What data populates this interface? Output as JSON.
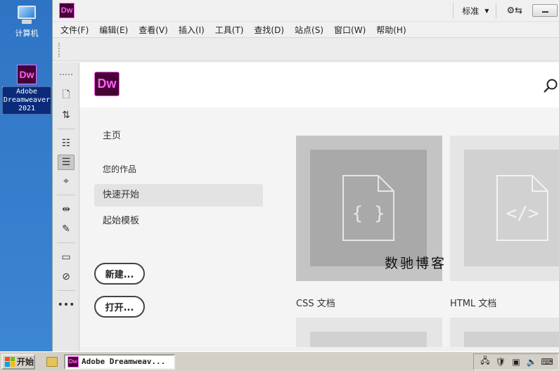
{
  "desktop": {
    "computer_label": "计算机",
    "dw_label_line1": "Adobe",
    "dw_label_line2": "Dreamweaver",
    "dw_label_line3": "2021"
  },
  "app": {
    "logo": "Dw",
    "workspace": "标准",
    "brand_color": "#ff61f6",
    "brand_bg": "#470137"
  },
  "menu": [
    "文件(F)",
    "编辑(E)",
    "查看(V)",
    "插入(I)",
    "工具(T)",
    "查找(D)",
    "站点(S)",
    "窗口(W)",
    "帮助(H)"
  ],
  "rail_icons": [
    "new-document-icon",
    "file-transfer-icon",
    "code-properties-icon",
    "align-icon",
    "target-icon",
    "expand-icon",
    "snippet-icon",
    "comment-icon",
    "comment-delete-icon",
    "more-icon"
  ],
  "start": {
    "logo": "Dw",
    "nav": {
      "home": "主页",
      "your_work": "您的作品",
      "quick_start": "快速开始",
      "starter_templates": "起始模板"
    },
    "new_button": "新建...",
    "open_button": "打开...",
    "cards": [
      {
        "label": "CSS 文档",
        "glyph": "{ }"
      },
      {
        "label": "HTML 文档",
        "glyph": "</>"
      }
    ],
    "watermark": "数驰博客"
  },
  "taskbar": {
    "start": "开始",
    "task": "Adobe Dreamweav..."
  }
}
